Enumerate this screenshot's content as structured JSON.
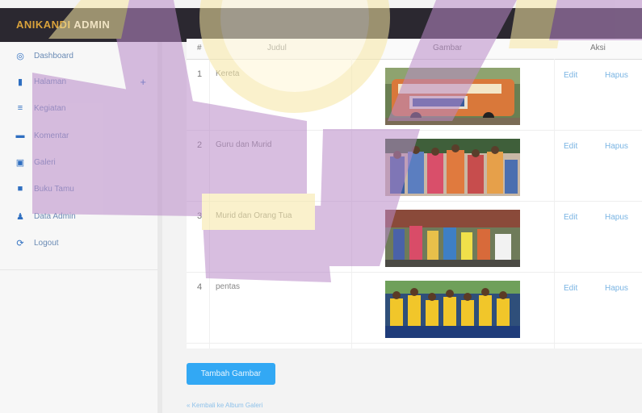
{
  "app": {
    "brand_prefix": "ANIKANDI",
    "brand_suffix": " ADMIN"
  },
  "sidebar": {
    "items": [
      {
        "icon": "dashboard-icon",
        "label": "Dashboard"
      },
      {
        "icon": "file-icon",
        "label": "Halaman"
      },
      {
        "icon": "list-icon",
        "label": "Kegiatan"
      },
      {
        "icon": "comment-icon",
        "label": "Komentar"
      },
      {
        "icon": "image-icon",
        "label": "Galeri"
      },
      {
        "icon": "book-icon",
        "label": "Buku Tamu"
      },
      {
        "icon": "user-icon",
        "label": "Data Admin"
      },
      {
        "icon": "logout-icon",
        "label": "Logout"
      }
    ]
  },
  "table": {
    "headers": {
      "no": "#",
      "title": "Judul",
      "image": "Gambar",
      "action": "Aksi"
    },
    "rows": [
      {
        "no": "1",
        "title": "Kereta",
        "image": "bus-photo",
        "edit": "Edit",
        "delete": "Hapus"
      },
      {
        "no": "2",
        "title": "Guru dan Murid",
        "image": "teachers-photo",
        "edit": "Edit",
        "delete": "Hapus"
      },
      {
        "no": "3",
        "title": "Murid dan Orang Tua",
        "image": "parents-photo",
        "edit": "Edit",
        "delete": "Hapus"
      },
      {
        "no": "4",
        "title": "pentas",
        "image": "kids-photo",
        "edit": "Edit",
        "delete": "Hapus"
      }
    ]
  },
  "actions": {
    "add_label": "Tambah Gambar",
    "back_label": "« Kembali ke Album Galeri"
  },
  "colors": {
    "topbar": "#2b2830",
    "accent_button": "#32a8f4",
    "link": "#7ab4e3",
    "overlay_purple": "#b98ac8",
    "overlay_yellow": "#f7e7a4"
  }
}
